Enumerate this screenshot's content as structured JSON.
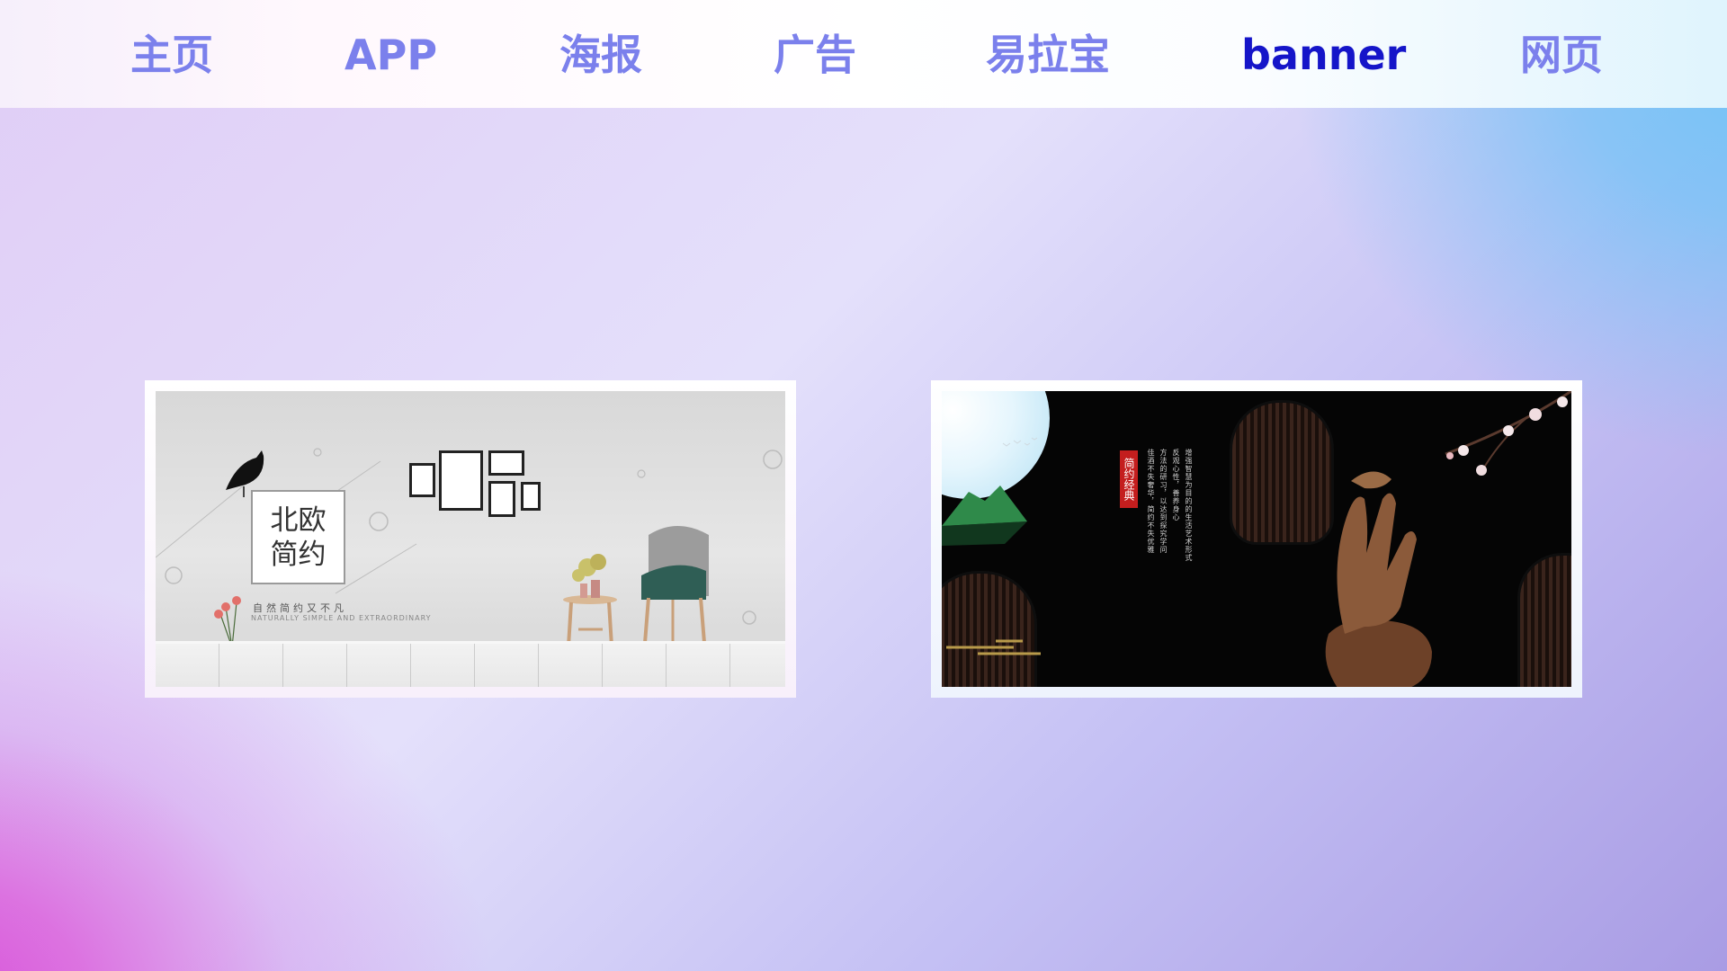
{
  "nav": {
    "items": [
      {
        "label": "主页"
      },
      {
        "label": "APP"
      },
      {
        "label": "海报"
      },
      {
        "label": "广告"
      },
      {
        "label": "易拉宝"
      },
      {
        "label": "banner"
      },
      {
        "label": "网页"
      }
    ],
    "active_index": 5
  },
  "colors": {
    "nav_text": "#7b80ec",
    "nav_active": "#1515c9"
  },
  "banners": {
    "left": {
      "title_line1": "北欧",
      "title_line2": "简约",
      "subtitle_cn": "自然简约又不凡",
      "subtitle_en": "NATURALLY SIMPLE AND EXTRAORDINARY"
    },
    "right": {
      "tag": "简约经典",
      "vertical_lines": [
        "增强智慧为目的的生活艺术形式",
        "反观心性，善养身心",
        "方法的研习，以达到探究学问",
        "佳酒不失奢华，简约不失优雅"
      ]
    }
  }
}
